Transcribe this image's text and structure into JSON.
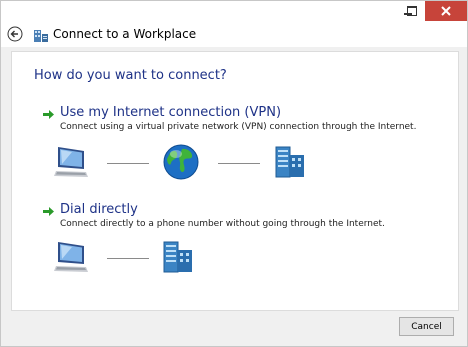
{
  "window": {
    "title": "Connect to a Workplace"
  },
  "titlebar": {
    "minimize_icon": "minimize-icon",
    "maximize_icon": "maximize-icon",
    "close_icon": "close-icon",
    "close_color": "#c7443a"
  },
  "main": {
    "heading": "How do you want to connect?",
    "options": [
      {
        "title": "Use my Internet connection (VPN)",
        "description": "Connect using a virtual private network (VPN) connection through the Internet."
      },
      {
        "title": "Dial directly",
        "description": "Connect directly to a phone number without going through the Internet."
      }
    ]
  },
  "footer": {
    "cancel_label": "Cancel"
  },
  "colors": {
    "heading": "#1e3287",
    "arrow": "#2a9a2a"
  }
}
